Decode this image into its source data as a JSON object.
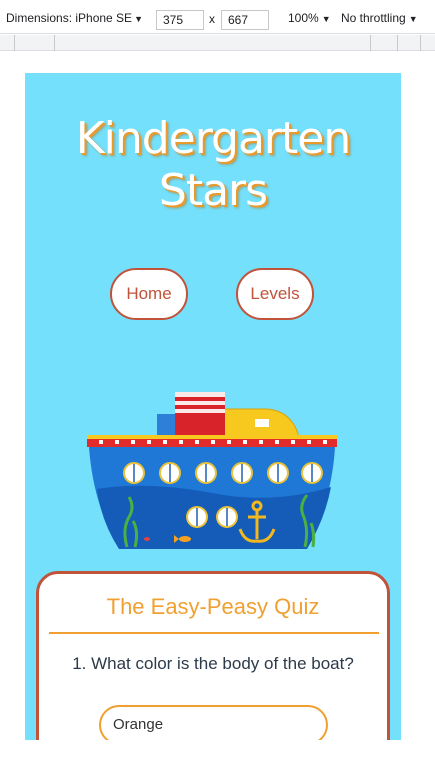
{
  "devtools": {
    "device_label": "Dimensions: iPhone SE",
    "width_value": "375",
    "times": "x",
    "height_value": "667",
    "zoom": "100%",
    "throttling": "No throttling"
  },
  "header": {
    "title_line1": "Kindergarten",
    "title_line2": "Stars"
  },
  "nav": {
    "home_label": "Home",
    "levels_label": "Levels"
  },
  "quiz": {
    "title": "The Easy-Peasy Quiz",
    "question": "1. What color is the body of the boat?",
    "options": [
      "Orange"
    ]
  },
  "colors": {
    "page_bg": "#74e0fb",
    "accent_orange": "#f0a030",
    "accent_red": "#c0533a"
  }
}
